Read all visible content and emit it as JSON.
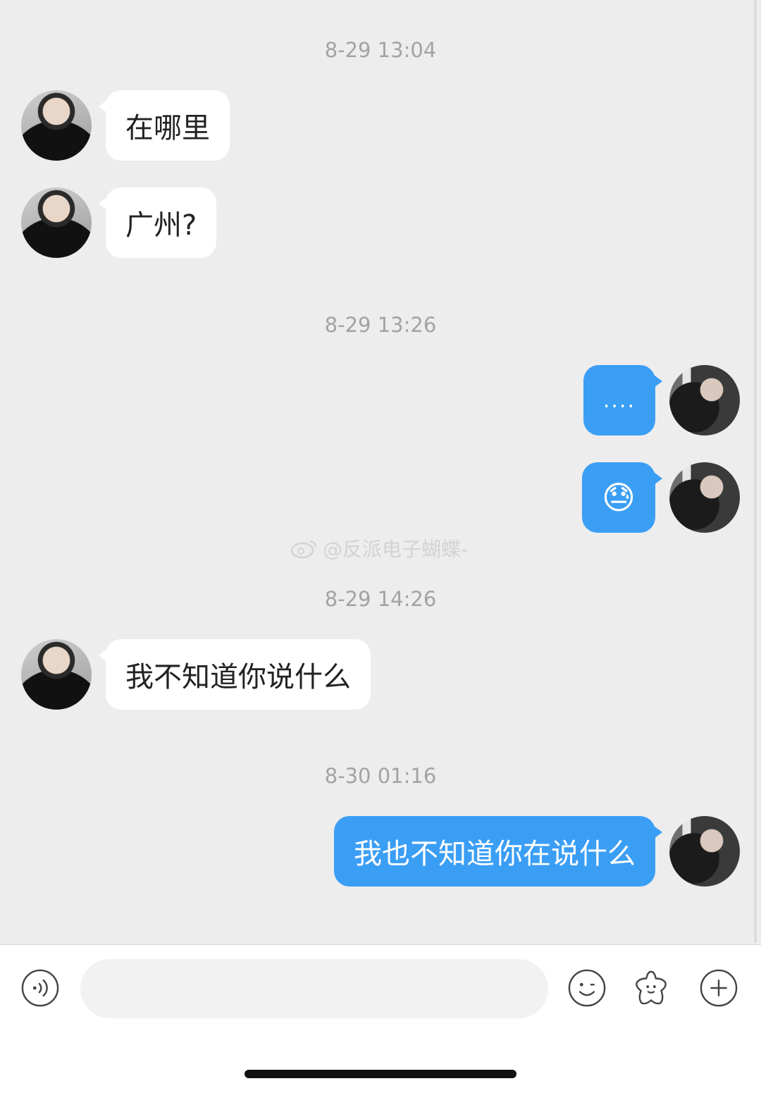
{
  "messages": [
    {
      "type": "time",
      "text": "8-29 13:04"
    },
    {
      "type": "msg",
      "side": "left",
      "avatar": "contact-avatar",
      "text": "在哪里"
    },
    {
      "type": "msg",
      "side": "left",
      "avatar": "contact-avatar",
      "text": "广州?"
    },
    {
      "type": "time",
      "text": "8-29 13:26"
    },
    {
      "type": "msg",
      "side": "right",
      "avatar": "self-avatar",
      "text": "...."
    },
    {
      "type": "msg",
      "side": "right",
      "avatar": "self-avatar",
      "text": "😓"
    },
    {
      "type": "time",
      "text": "8-29 14:26"
    },
    {
      "type": "msg",
      "side": "left",
      "avatar": "contact-avatar",
      "text": "我不知道你说什么"
    },
    {
      "type": "time",
      "text": "8-30 01:16"
    },
    {
      "type": "msg",
      "side": "right",
      "avatar": "self-avatar",
      "text": "我也不知道你在说什么"
    }
  ],
  "watermark": {
    "text": "@反派电子蝴蝶-",
    "icon": "weibo-icon"
  },
  "toolbar": {
    "voice_icon": "voice-icon",
    "input_value": "",
    "emoji_icon": "smiley-icon",
    "sticker_icon": "star-sticker-icon",
    "more_icon": "plus-circle-icon"
  },
  "colors": {
    "sent_bubble": "#3b9ef5",
    "received_bubble": "#ffffff",
    "background": "#ededed",
    "timestamp": "#a3a3a3"
  }
}
